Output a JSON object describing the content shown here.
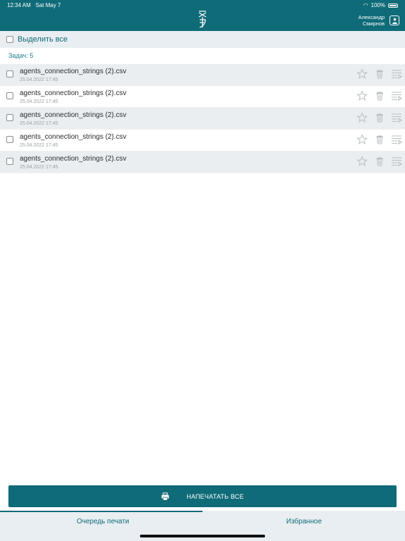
{
  "status": {
    "time": "12:34 AM",
    "date": "Sat May 7",
    "battery": "100%"
  },
  "header": {
    "user_name_line1": "Александр",
    "user_name_line2": "Смирнов"
  },
  "select_all": {
    "label": "Выделить все"
  },
  "task_count": "Задач: 5",
  "tasks": [
    {
      "title": "agents_connection_strings (2).csv",
      "date": "25.04.2022 17:45"
    },
    {
      "title": "agents_connection_strings (2).csv",
      "date": "25.04.2022 17:45"
    },
    {
      "title": "agents_connection_strings (2).csv",
      "date": "25.04.2022 17:45"
    },
    {
      "title": "agents_connection_strings (2).csv",
      "date": "25.04.2022 17:45"
    },
    {
      "title": "agents_connection_strings (2).csv",
      "date": "25.04.2022 17:45"
    }
  ],
  "print_all_label": "НАПЕЧАТАТЬ ВСЕ",
  "tabs": {
    "queue": "Очередь печати",
    "favorites": "Избранное"
  },
  "colors": {
    "primary": "#0f6b78",
    "row_alt": "#eaeef1",
    "icon_gray": "#b9bec2"
  }
}
